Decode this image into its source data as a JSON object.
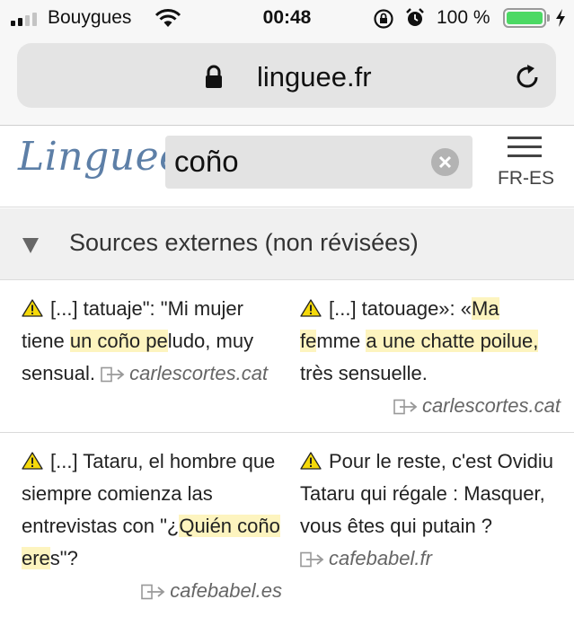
{
  "status_bar": {
    "carrier": "Bouygues",
    "time": "00:48",
    "battery_percent": "100 %",
    "battery_level": 1.0,
    "signal_bars": 4,
    "signal_bars_active": 2
  },
  "browser": {
    "url": "linguee.fr"
  },
  "header": {
    "logo": "Linguee",
    "search_value": "coño",
    "lang_pair": "FR-ES"
  },
  "section": {
    "title": "Sources externes (non révisées)"
  },
  "results": [
    {
      "source": {
        "parts": [
          {
            "text": "[...] tatuaje\": \"Mi mujer tiene ",
            "hl": false
          },
          {
            "text": "un coño pe",
            "hl": true
          },
          {
            "text": "ludo, muy sensual.",
            "hl": false
          }
        ],
        "site": "carlescortes.cat"
      },
      "target": {
        "parts": [
          {
            "text": "[...] tatouage»: «",
            "hl": false
          },
          {
            "text": "Ma fe",
            "hl": true
          },
          {
            "text": "mme ",
            "hl": false
          },
          {
            "text": "a une chatte poilue,",
            "hl": true
          },
          {
            "text": " très sensuelle.",
            "hl": false
          }
        ],
        "site": "carlescortes.cat"
      }
    },
    {
      "source": {
        "parts": [
          {
            "text": "[...] Tataru, el hombre que siempre comienza las entrevistas con \"¿",
            "hl": false
          },
          {
            "text": "Quién coño ere",
            "hl": true
          },
          {
            "text": "s\"?",
            "hl": false
          }
        ],
        "site": "cafebabel.es"
      },
      "target": {
        "parts": [
          {
            "text": "Pour le reste, c'est Ovidiu Tataru qui régale : Masquer, vous êtes qui putain ?",
            "hl": false
          }
        ],
        "site": "cafebabel.fr"
      }
    }
  ],
  "colors": {
    "highlight": "#fdf4bf",
    "logo": "#5d7fa7",
    "battery": "#4cd964",
    "warning": "#f5d90a"
  }
}
